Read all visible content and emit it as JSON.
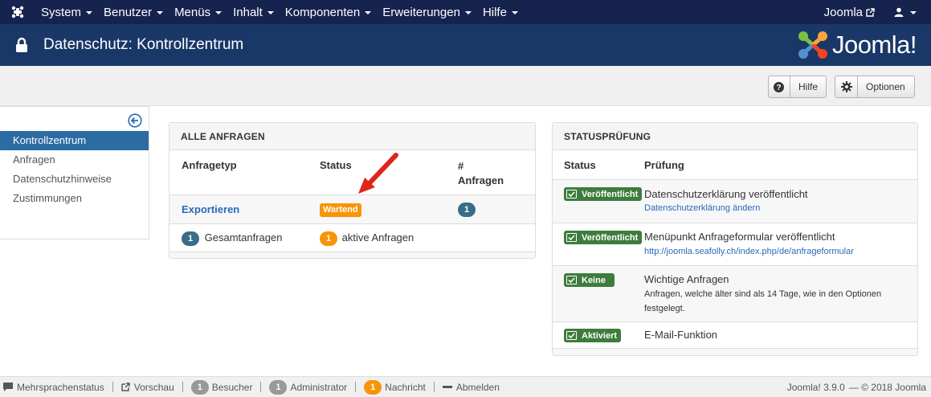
{
  "navbar": {
    "menu": [
      "System",
      "Benutzer",
      "Menüs",
      "Inhalt",
      "Komponenten",
      "Erweiterungen",
      "Hilfe"
    ],
    "site_link": "Joomla"
  },
  "header": {
    "title": "Datenschutz: Kontrollzentrum",
    "brand": "Joomla!"
  },
  "toolbar": {
    "help_label": "Hilfe",
    "options_label": "Optionen"
  },
  "sidebar": {
    "items": [
      "Kontrollzentrum",
      "Anfragen",
      "Datenschutzhinweise",
      "Zustimmungen"
    ]
  },
  "requests_panel": {
    "title": "ALLE ANFRAGEN",
    "col_type": "Anfragetyp",
    "col_status": "Status",
    "col_count_line1": "#",
    "col_count_line2": "Anfragen",
    "row_type": "Exportieren",
    "row_status": "Wartend",
    "row_count": "1",
    "total_count": "1",
    "total_label": "Gesamtanfragen",
    "active_count": "1",
    "active_label": "aktive Anfragen"
  },
  "status_panel": {
    "title": "STATUSPRÜFUNG",
    "col_status": "Status",
    "col_check": "Prüfung",
    "rows": [
      {
        "status": "Veröffentlicht",
        "title": "Datenschutzerklärung veröffentlicht",
        "sub": "Datenschutzerklärung ändern"
      },
      {
        "status": "Veröffentlicht",
        "title": "Menüpunkt Anfrageformular veröffentlicht",
        "sub": "http://joomla.seafolly.ch/index.php/de/anfrageformular"
      },
      {
        "status": "Keine",
        "title": "Wichtige Anfragen",
        "sub_line1": "Anfragen, welche älter sind als 14 Tage, wie in den Optionen",
        "sub_line2": "festgelegt."
      },
      {
        "status": "Aktiviert",
        "title": "E-Mail-Funktion"
      }
    ]
  },
  "footer": {
    "multilang": "Mehrsprachenstatus",
    "preview": "Vorschau",
    "visitors_count": "1",
    "visitors": "Besucher",
    "admin_count": "1",
    "admin": "Administrator",
    "messages_count": "1",
    "messages": "Nachricht",
    "logout": "Abmelden",
    "version": "Joomla! 3.9.0",
    "copyright": "— © 2018 Joomla"
  },
  "colors": {
    "navbar": "#17234f",
    "header": "#1a3867",
    "active": "#2d6ca2",
    "success": "#3d7c3d",
    "warning": "#f89406",
    "info": "#3a6d8a",
    "arrow": "#e0251b"
  }
}
